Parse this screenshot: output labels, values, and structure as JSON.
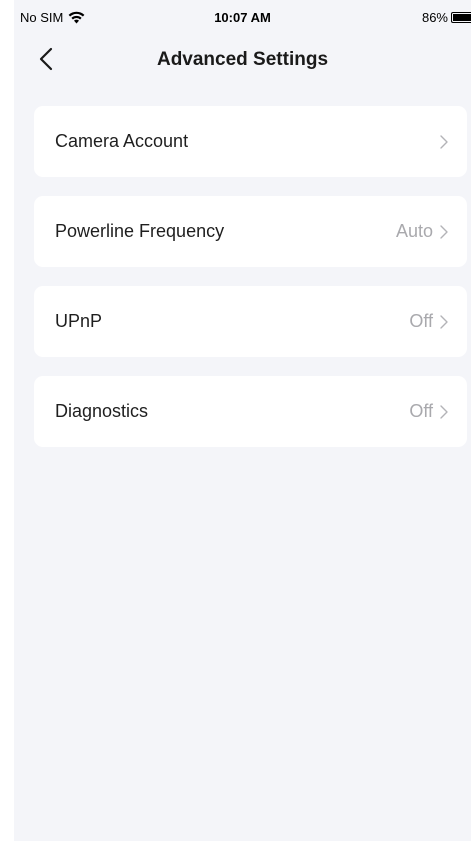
{
  "status_bar": {
    "carrier": "No SIM",
    "time": "10:07 AM",
    "battery": "86%"
  },
  "nav": {
    "title": "Advanced Settings",
    "back_icon": "chevron-left-icon"
  },
  "settings": {
    "items": [
      {
        "label": "Camera Account",
        "value": ""
      },
      {
        "label": "Powerline Frequency",
        "value": "Auto"
      },
      {
        "label": "UPnP",
        "value": "Off"
      },
      {
        "label": "Diagnostics",
        "value": "Off"
      }
    ]
  },
  "colors": {
    "background": "#f4f5f9",
    "card": "#ffffff",
    "text": "#1f1f1f",
    "secondary_text": "#a9a9ad"
  }
}
